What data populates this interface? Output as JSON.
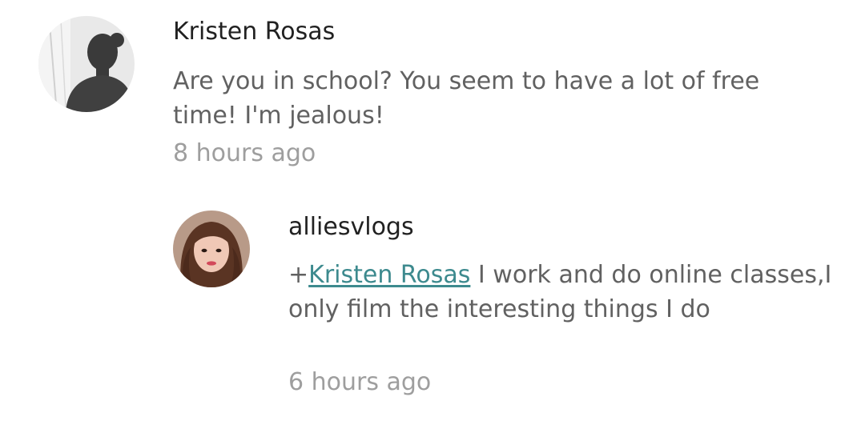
{
  "comments": [
    {
      "author": "Kristen Rosas",
      "text": "Are you in school? You seem to have a lot of free time! I'm jealous!",
      "timestamp": "8 hours ago",
      "avatar_icon": "silhouette-avatar-icon"
    },
    {
      "author": "alliesvlogs",
      "mention_prefix": "+",
      "mention": "Kristen Rosas",
      "text": " I work and do online classes,I only film the interesting things I do",
      "timestamp": "6 hours ago",
      "avatar_icon": "portrait-avatar-icon",
      "is_reply": true
    }
  ],
  "colors": {
    "author": "#212121",
    "body": "#616161",
    "timestamp": "#9e9e9e",
    "mention_link": "#3d8a8e"
  }
}
